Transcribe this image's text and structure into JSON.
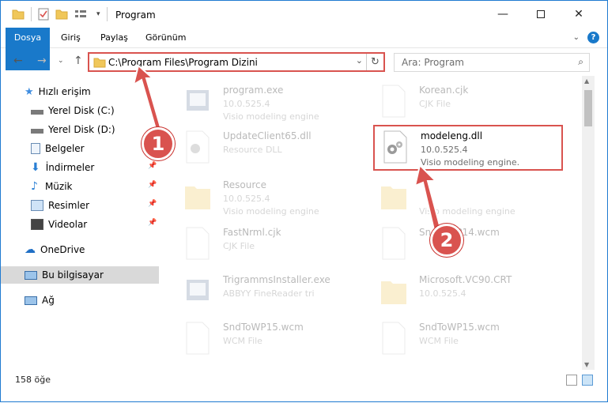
{
  "window": {
    "title": "Program",
    "accent": "#1979ca",
    "highlight": "#d9534f"
  },
  "ribbon": {
    "tabs": [
      "Dosya",
      "Giriş",
      "Paylaş",
      "Görünüm"
    ]
  },
  "address": {
    "path": "C:\\Program Files\\Program Dizini"
  },
  "search": {
    "placeholder": "Ara: Program"
  },
  "sidebar": {
    "items": [
      {
        "label": "Hızlı erişim",
        "icon": "star-icon"
      },
      {
        "label": "Yerel Disk (C:)",
        "icon": "drive-icon"
      },
      {
        "label": "Yerel Disk (D:)",
        "icon": "drive-icon"
      },
      {
        "label": "Belgeler",
        "icon": "documents-icon"
      },
      {
        "label": "İndirmeler",
        "icon": "download-icon"
      },
      {
        "label": "Müzik",
        "icon": "music-icon"
      },
      {
        "label": "Resimler",
        "icon": "pictures-icon"
      },
      {
        "label": "Videolar",
        "icon": "videos-icon"
      },
      {
        "label": "OneDrive",
        "icon": "cloud-icon"
      },
      {
        "label": "Bu bilgisayar",
        "icon": "computer-icon"
      },
      {
        "label": "Ağ",
        "icon": "network-icon"
      }
    ]
  },
  "files": [
    {
      "name": "program.exe",
      "meta1": "10.0.525.4",
      "meta2": "Visio modeling engine",
      "icon": "exe-icon"
    },
    {
      "name": "Korean.cjk",
      "meta1": "CJK File",
      "meta2": "",
      "icon": "file-icon"
    },
    {
      "name": "UpdateClient65.dll",
      "meta1": "Resource DLL",
      "meta2": "",
      "icon": "dll-icon"
    },
    {
      "name": "modeleng.dll",
      "meta1": "10.0.525.4",
      "meta2": "Visio modeling engine.",
      "icon": "dll-icon"
    },
    {
      "name": "Resource",
      "meta1": "10.0.525.4",
      "meta2": "Visio modeling engine",
      "icon": "folder-icon"
    },
    {
      "name": "",
      "meta1": "",
      "meta2": "Visio modeling engine",
      "icon": "folder-icon"
    },
    {
      "name": "FastNrml.cjk",
      "meta1": "CJK File",
      "meta2": "",
      "icon": "file-icon"
    },
    {
      "name": "SndToWP14.wcm",
      "meta1": "",
      "meta2": "",
      "icon": "file-icon"
    },
    {
      "name": "TrigrammsInstaller.exe",
      "meta1": "ABBYY FineReader tri",
      "meta2": "",
      "icon": "exe-icon"
    },
    {
      "name": "Microsoft.VC90.CRT",
      "meta1": "10.0.525.4",
      "meta2": "",
      "icon": "folder-icon"
    },
    {
      "name": "SndToWP15.wcm",
      "meta1": "WCM File",
      "meta2": "",
      "icon": "file-icon"
    },
    {
      "name": "SndToWP15.wcm",
      "meta1": "WCM File",
      "meta2": "",
      "icon": "file-icon"
    }
  ],
  "status": {
    "count": "158 öğe"
  },
  "callouts": {
    "one": "1",
    "two": "2"
  }
}
